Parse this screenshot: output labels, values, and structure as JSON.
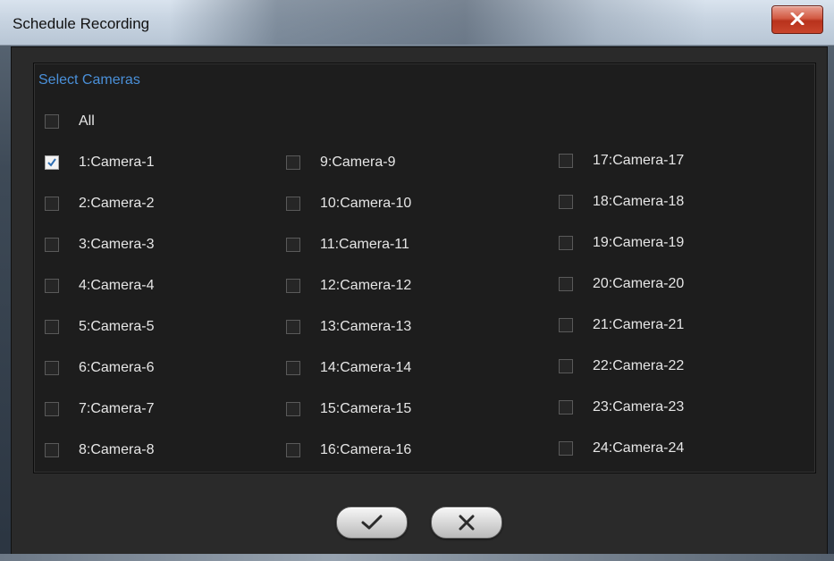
{
  "window": {
    "title": "Schedule Recording",
    "close_icon": "close-x-icon"
  },
  "panel": {
    "title": "Select Cameras",
    "all_label": "All",
    "all_checked": false,
    "cameras": [
      {
        "label": "1:Camera-1",
        "checked": true
      },
      {
        "label": "2:Camera-2",
        "checked": false
      },
      {
        "label": "3:Camera-3",
        "checked": false
      },
      {
        "label": "4:Camera-4",
        "checked": false
      },
      {
        "label": "5:Camera-5",
        "checked": false
      },
      {
        "label": "6:Camera-6",
        "checked": false
      },
      {
        "label": "7:Camera-7",
        "checked": false
      },
      {
        "label": "8:Camera-8",
        "checked": false
      },
      {
        "label": "9:Camera-9",
        "checked": false
      },
      {
        "label": "10:Camera-10",
        "checked": false
      },
      {
        "label": "11:Camera-11",
        "checked": false
      },
      {
        "label": "12:Camera-12",
        "checked": false
      },
      {
        "label": "13:Camera-13",
        "checked": false
      },
      {
        "label": "14:Camera-14",
        "checked": false
      },
      {
        "label": "15:Camera-15",
        "checked": false
      },
      {
        "label": "16:Camera-16",
        "checked": false
      },
      {
        "label": "17:Camera-17",
        "checked": false
      },
      {
        "label": "18:Camera-18",
        "checked": false
      },
      {
        "label": "19:Camera-19",
        "checked": false
      },
      {
        "label": "20:Camera-20",
        "checked": false
      },
      {
        "label": "21:Camera-21",
        "checked": false
      },
      {
        "label": "22:Camera-22",
        "checked": false
      },
      {
        "label": "23:Camera-23",
        "checked": false
      },
      {
        "label": "24:Camera-24",
        "checked": false
      }
    ]
  },
  "actions": {
    "ok_icon": "checkmark-icon",
    "cancel_icon": "close-x-icon"
  },
  "colors": {
    "accent": "#4a90d9",
    "panel_bg": "#1d1d1d",
    "dialog_bg": "#2a2a2a",
    "close_button": "#c9452c"
  }
}
